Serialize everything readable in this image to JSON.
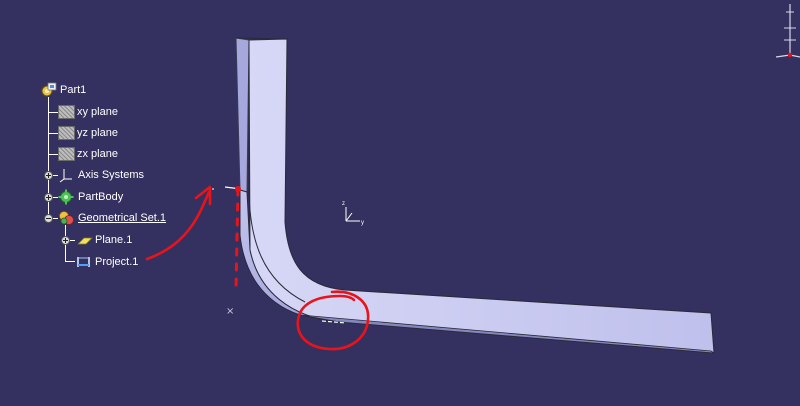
{
  "tree": {
    "root": {
      "label": "Part1",
      "icon": "part-gear-icon"
    },
    "items": [
      {
        "label": "xy plane",
        "icon": "plane-icon"
      },
      {
        "label": "yz plane",
        "icon": "plane-icon"
      },
      {
        "label": "zx plane",
        "icon": "plane-icon"
      },
      {
        "label": "Axis Systems",
        "icon": "axis-systems-icon"
      },
      {
        "label": "PartBody",
        "icon": "partbody-gear-icon"
      },
      {
        "label": "Geometrical Set.1",
        "icon": "geometrical-set-icon"
      },
      {
        "label": "Plane.1",
        "icon": "plane-feature-icon"
      },
      {
        "label": "Project.1",
        "icon": "project-icon"
      }
    ]
  },
  "compass": {
    "axis_labels": [
      "z",
      "x",
      "y"
    ]
  },
  "annotation": {
    "color": "#e8141c"
  },
  "colors": {
    "background": "#34305f",
    "part_face_light": "#c9c9ef",
    "part_face_mid": "#9e9ed6",
    "part_edge_dark": "#2a2a3a"
  }
}
